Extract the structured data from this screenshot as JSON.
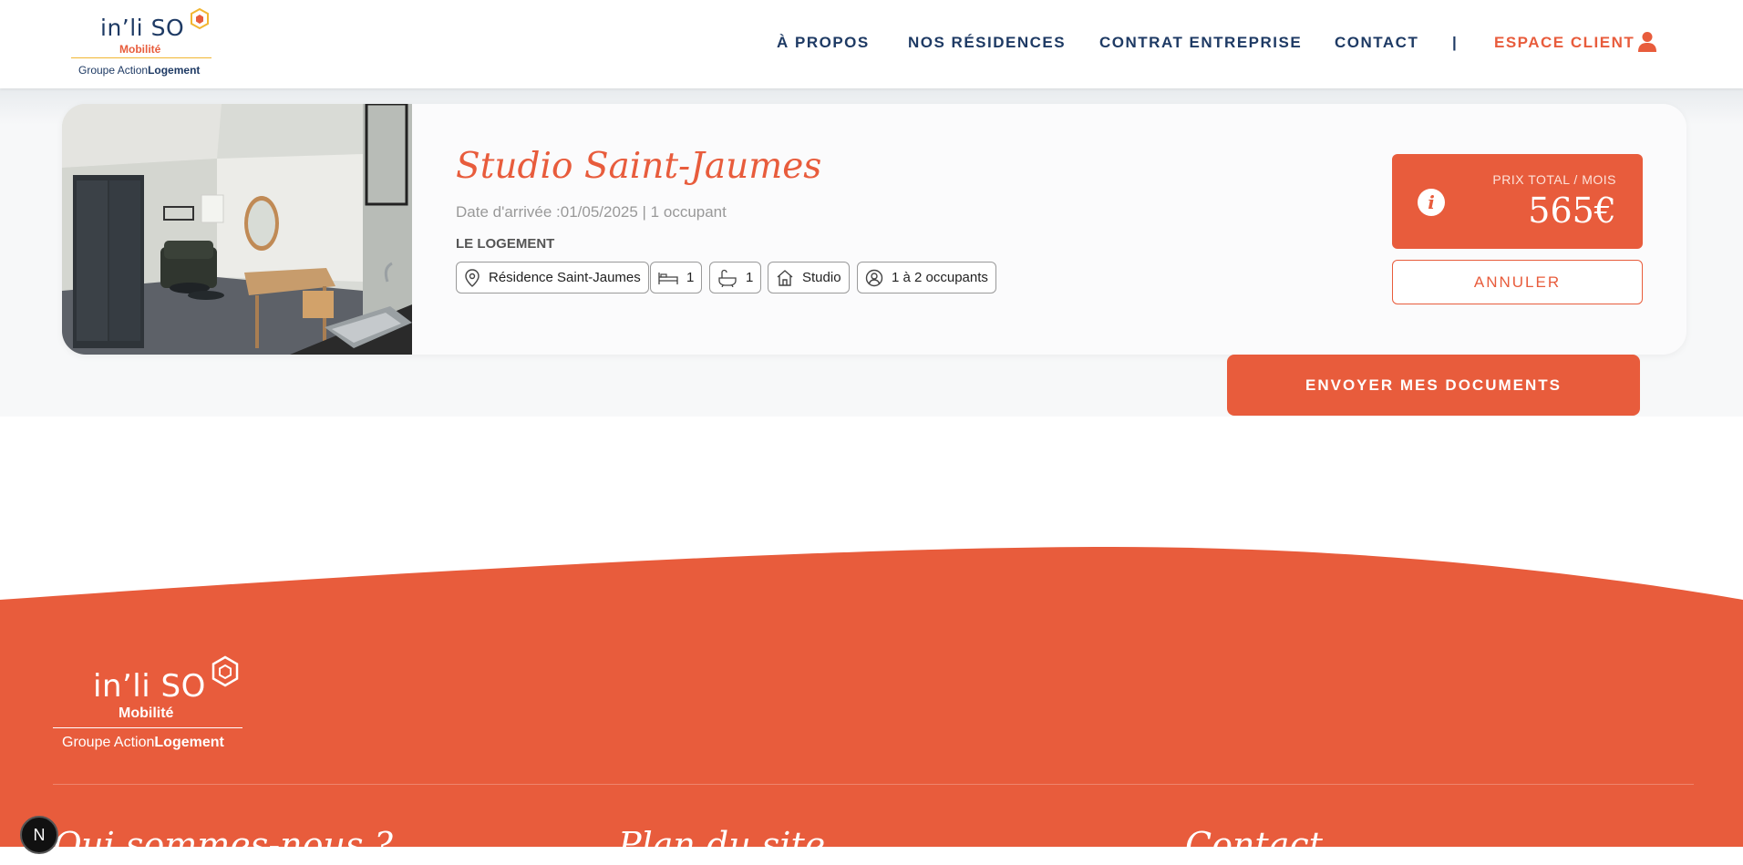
{
  "logo": {
    "brand": "in’li SO",
    "sub": "Mobilité",
    "group_prefix": "Groupe Action",
    "group_bold": "Logement"
  },
  "nav": {
    "items": [
      "À PROPOS",
      "NOS RÉSIDENCES",
      "CONTRAT ENTREPRISE",
      "CONTACT"
    ],
    "separator": "|",
    "client_label": "ESPACE CLIENT"
  },
  "listing": {
    "title": "Studio Saint-Jaumes",
    "meta": "Date d'arrivée :01/05/2025 | 1 occupant",
    "section_label": "LE LOGEMENT",
    "tags": {
      "residence": "Résidence Saint-Jaumes",
      "beds": "1",
      "baths": "1",
      "type": "Studio",
      "occupants": "1 à 2 occupants"
    },
    "price_label": "PRIX TOTAL / MOIS",
    "price_value": "565€",
    "info_glyph": "i",
    "cancel_label": "ANNULER",
    "send_docs_label": "ENVOYER MES DOCUMENTS"
  },
  "footer": {
    "logo": {
      "brand": "in’li SO",
      "sub": "Mobilité",
      "group_prefix": "Groupe Action",
      "group_bold": "Logement"
    },
    "headings": [
      "Qui sommes-nous ?",
      "Plan du site",
      "Contact"
    ]
  },
  "badge": "N",
  "colors": {
    "accent": "#e85c3c",
    "navy": "#1e3a64",
    "band": "#f7f8f9"
  }
}
